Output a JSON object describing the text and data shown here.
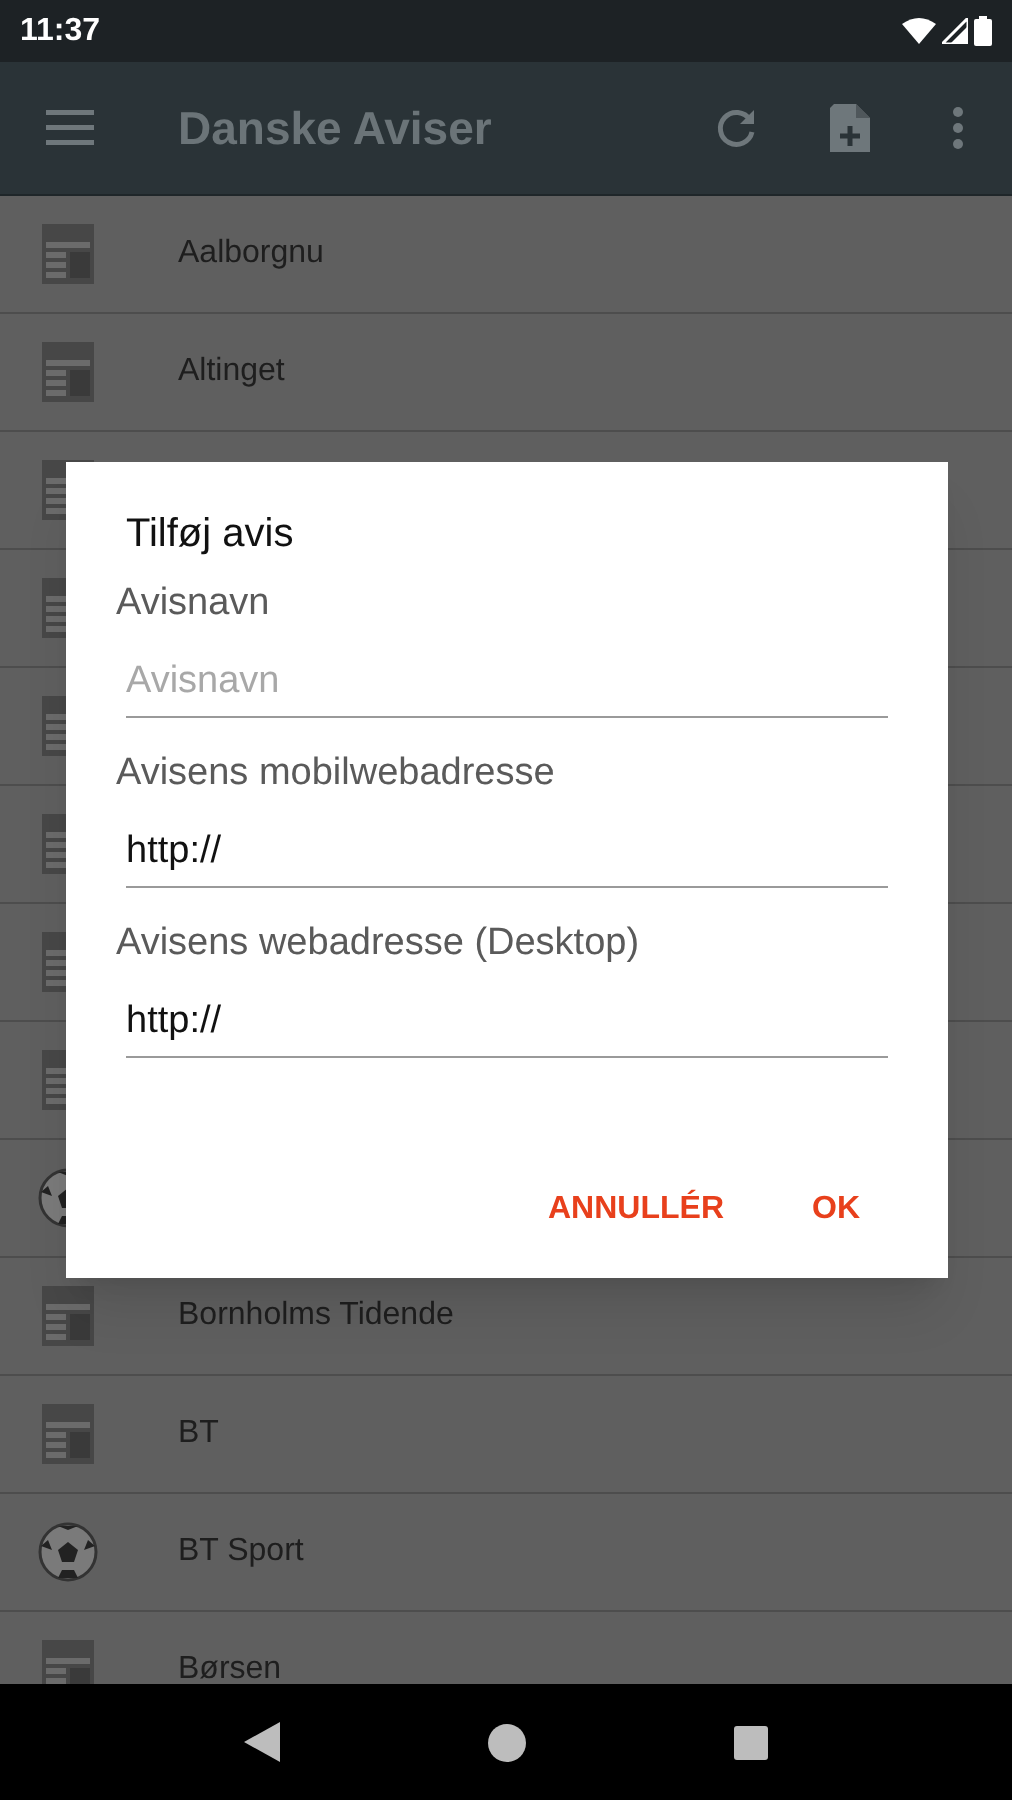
{
  "status_bar": {
    "time": "11:37"
  },
  "app_bar": {
    "title": "Danske Aviser"
  },
  "list": [
    {
      "kind": "newspaper",
      "label": "Aalborgnu"
    },
    {
      "kind": "newspaper",
      "label": "Altinget"
    },
    {
      "kind": "newspaper"
    },
    {
      "kind": "newspaper"
    },
    {
      "kind": "newspaper"
    },
    {
      "kind": "newspaper"
    },
    {
      "kind": "newspaper"
    },
    {
      "kind": "newspaper"
    },
    {
      "kind": "sport"
    },
    {
      "kind": "newspaper",
      "label": "Bornholms Tidende"
    },
    {
      "kind": "newspaper",
      "label": "BT"
    },
    {
      "kind": "sport",
      "label": "BT Sport"
    },
    {
      "kind": "newspaper",
      "label": "Børsen"
    }
  ],
  "dialog": {
    "title": "Tilføj avis",
    "fields": [
      {
        "label": "Avisnavn",
        "placeholder": "Avisnavn"
      },
      {
        "label": "Avisens mobilwebadresse",
        "value": "http://"
      },
      {
        "label": "Avisens webadresse (Desktop)",
        "value": "http://"
      }
    ],
    "buttons": [
      "ANNULLÉR",
      "OK"
    ]
  }
}
